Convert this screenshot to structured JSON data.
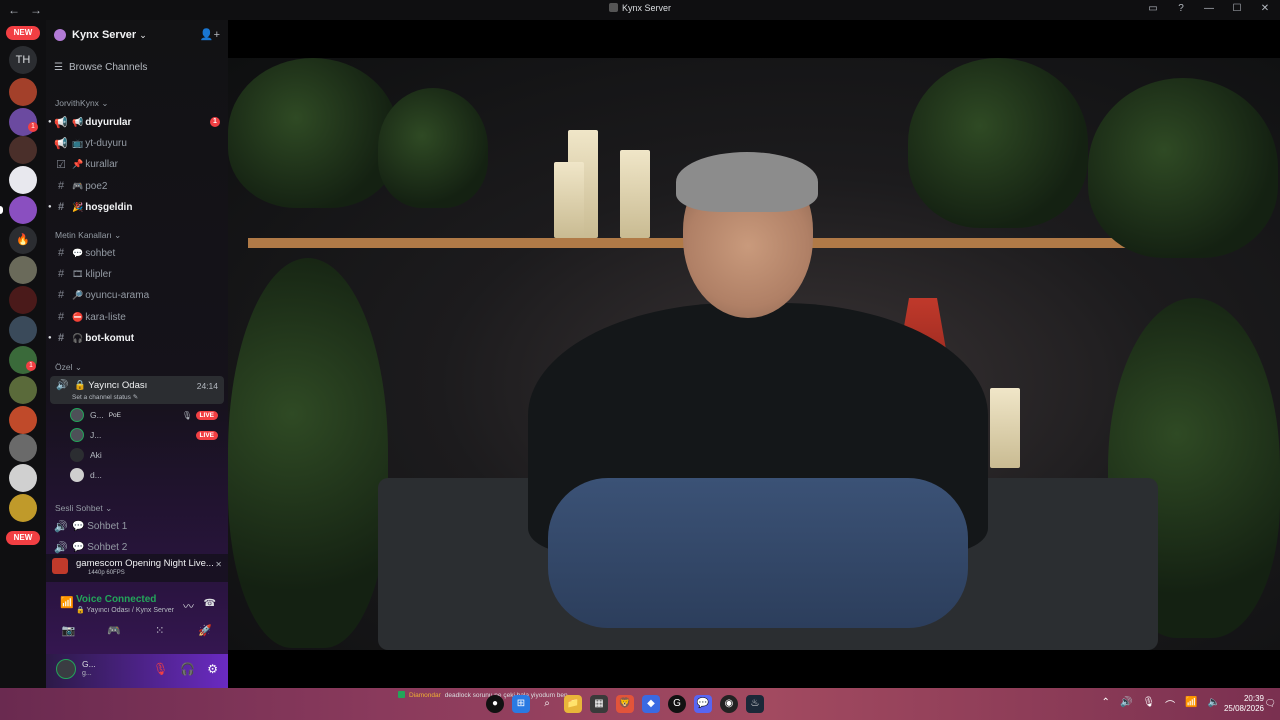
{
  "window": {
    "title": "Kynx Server",
    "nav_back": "←",
    "nav_forward": "→",
    "controls": [
      "▭",
      "?",
      "—",
      "☐",
      "✕"
    ]
  },
  "rail": {
    "new_badge_top": "NEW",
    "new_badge_bottom": "NEW",
    "th_label": "TH",
    "badges": [
      "1",
      "1"
    ]
  },
  "server": {
    "name": "Kynx Server",
    "chevron": "⌄",
    "invite_icon": "👤+"
  },
  "browse_channels": "Browse Channels",
  "categories": [
    {
      "name": "JorvithKynx",
      "chevron": "⌄"
    },
    {
      "name": "Metin Kanalları",
      "chevron": "⌄"
    },
    {
      "name": "Özel",
      "chevron": "⌄"
    },
    {
      "name": "Sesli Sohbet",
      "chevron": "⌄"
    }
  ],
  "channels": [
    {
      "icon": "📢",
      "emoji": "📢",
      "name": "duyurular",
      "unread": true,
      "badge": "1"
    },
    {
      "icon": "📢",
      "emoji": "📺",
      "name": "yt-duyuru",
      "unread": false
    },
    {
      "icon": "☑",
      "emoji": "📌",
      "name": "kurallar",
      "unread": false
    },
    {
      "icon": "#",
      "emoji": "🎮",
      "name": "poe2",
      "unread": false
    },
    {
      "icon": "#",
      "emoji": "🎉",
      "name": "hoşgeldin",
      "unread": true
    },
    {
      "icon": "#",
      "emoji": "💬",
      "name": "sohbet",
      "unread": false
    },
    {
      "icon": "#",
      "emoji": "🎞",
      "name": "klipler",
      "unread": false
    },
    {
      "icon": "#",
      "emoji": "🔎",
      "name": "oyuncu-arama",
      "unread": false
    },
    {
      "icon": "#",
      "emoji": "⛔",
      "name": "kara-liste",
      "unread": false
    },
    {
      "icon": "#",
      "emoji": "🎧",
      "name": "bot-komut",
      "unread": true
    }
  ],
  "voice_channel": {
    "name": "🔒 Yayıncı Odası",
    "status": "Set a channel status ✎",
    "time": "24:14",
    "users": [
      {
        "name": "G...",
        "tag": "PoE",
        "live": "LIVE",
        "muted_icon": "🎙"
      },
      {
        "name": "J...",
        "live": "LIVE"
      },
      {
        "name": "Aki"
      },
      {
        "name": "d..."
      }
    ]
  },
  "voice_channels": [
    {
      "icon": "🔊",
      "name": "💬 Sohbet 1"
    },
    {
      "icon": "🔊",
      "name": "💬 Sohbet 2"
    }
  ],
  "activity": {
    "title": "gamescom Opening Night Live...",
    "sub": "1440p 60FPS",
    "close": "✕"
  },
  "voice_panel": {
    "title": "Voice Connected",
    "sub": "🔒 Yayıncı Odası / Kynx Server",
    "buttons": [
      "📷",
      "🎮",
      "⁙",
      "🚀"
    ]
  },
  "user": {
    "name": "G...",
    "status": "g...",
    "mic": "🎙",
    "headset": "🎧",
    "settings": "⚙"
  },
  "toast": {
    "user": "Diamondar",
    "text": "deadlock sorunu ne çeki hala yiyodum ben"
  },
  "taskbar": {
    "apps": [
      "●",
      "⊞",
      "⌕",
      "📁",
      "▦",
      "🦁",
      "◆",
      "G",
      "💬",
      "◉",
      "♨"
    ],
    "tray": [
      "⌃",
      "🔊",
      "🎙",
      "⌒",
      "📶",
      "🔈"
    ],
    "time": "20:39",
    "date": "25/08/2026",
    "notif": "🗨"
  },
  "colors": {
    "accent_green": "#23a55a",
    "live_red": "#f23f43",
    "gradient_purple": "#6a2ac2"
  }
}
